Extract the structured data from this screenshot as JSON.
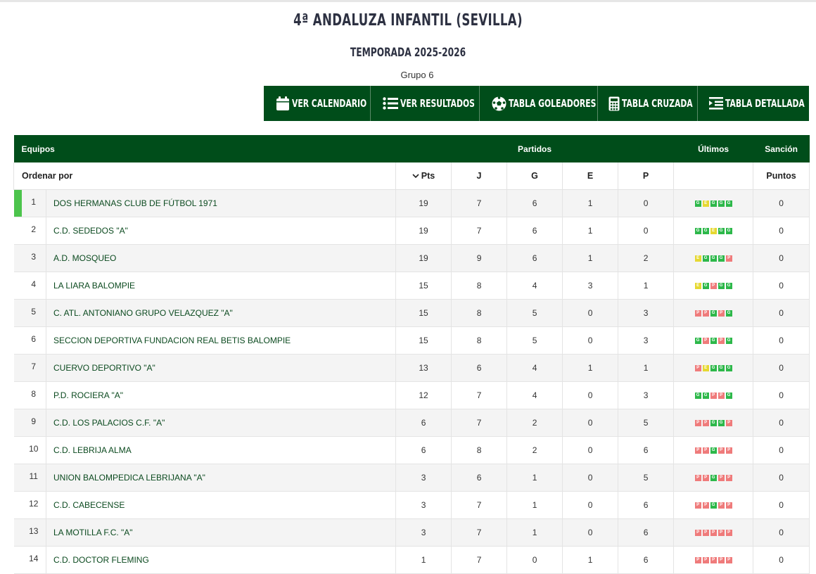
{
  "header": {
    "title": "4ª ANDALUZA INFANTIL (SEVILLA)",
    "season": "TEMPORADA 2025-2026",
    "group": "Grupo 6"
  },
  "actions": [
    {
      "label": "VER CALENDARIO",
      "icon": "calendar-icon"
    },
    {
      "label": "VER RESULTADOS",
      "icon": "list-icon"
    },
    {
      "label": "TABLA GOLEADORES",
      "icon": "ball-icon"
    },
    {
      "label": "TABLA CRUZADA",
      "icon": "calculator-icon"
    },
    {
      "label": "TABLA DETALLADA",
      "icon": "detailed-table-icon"
    }
  ],
  "table": {
    "head_teams": "Equipos",
    "head_matches": "Partidos",
    "head_last": "Últimos",
    "head_sanction": "Sanción",
    "sort_label": "Ordenar por",
    "col_pts": "Pts",
    "col_j": "J",
    "col_g": "G",
    "col_e": "E",
    "col_p": "P",
    "col_points": "Puntos",
    "colors": {
      "win": "#2db84a",
      "draw": "#e6d832",
      "loss": "#ef7b7b",
      "header": "#004d1a",
      "leader": "#4cc44c"
    },
    "rows": [
      {
        "pos": "1",
        "team": "DOS HERMANAS CLUB DE FÚTBOL 1971",
        "pts": "19",
        "j": "7",
        "g": "6",
        "e": "1",
        "p": "0",
        "last": [
          "G",
          "E",
          "G",
          "G",
          "G"
        ],
        "sanction": "0"
      },
      {
        "pos": "2",
        "team": "C.D. SEDEDOS \"A\"",
        "pts": "19",
        "j": "7",
        "g": "6",
        "e": "1",
        "p": "0",
        "last": [
          "G",
          "G",
          "E",
          "G",
          "G"
        ],
        "sanction": "0"
      },
      {
        "pos": "3",
        "team": "A.D. MOSQUEO",
        "pts": "19",
        "j": "9",
        "g": "6",
        "e": "1",
        "p": "2",
        "last": [
          "E",
          "G",
          "G",
          "G",
          "P"
        ],
        "sanction": "0"
      },
      {
        "pos": "4",
        "team": "LA LIARA BALOMPIE",
        "pts": "15",
        "j": "8",
        "g": "4",
        "e": "3",
        "p": "1",
        "last": [
          "E",
          "G",
          "P",
          "G",
          "G"
        ],
        "sanction": "0"
      },
      {
        "pos": "5",
        "team": "C. ATL. ANTONIANO GRUPO VELAZQUEZ \"A\"",
        "pts": "15",
        "j": "8",
        "g": "5",
        "e": "0",
        "p": "3",
        "last": [
          "P",
          "P",
          "G",
          "P",
          "G"
        ],
        "sanction": "0"
      },
      {
        "pos": "6",
        "team": "SECCION DEPORTIVA FUNDACION REAL BETIS BALOMPIE",
        "pts": "15",
        "j": "8",
        "g": "5",
        "e": "0",
        "p": "3",
        "last": [
          "G",
          "P",
          "G",
          "P",
          "G"
        ],
        "sanction": "0"
      },
      {
        "pos": "7",
        "team": "CUERVO DEPORTIVO \"A\"",
        "pts": "13",
        "j": "6",
        "g": "4",
        "e": "1",
        "p": "1",
        "last": [
          "P",
          "E",
          "G",
          "G",
          "G"
        ],
        "sanction": "0"
      },
      {
        "pos": "8",
        "team": "P.D. ROCIERA \"A\"",
        "pts": "12",
        "j": "7",
        "g": "4",
        "e": "0",
        "p": "3",
        "last": [
          "G",
          "G",
          "P",
          "P",
          "G"
        ],
        "sanction": "0"
      },
      {
        "pos": "9",
        "team": "C.D. LOS PALACIOS C.F. \"A\"",
        "pts": "6",
        "j": "7",
        "g": "2",
        "e": "0",
        "p": "5",
        "last": [
          "P",
          "P",
          "G",
          "G",
          "P"
        ],
        "sanction": "0"
      },
      {
        "pos": "10",
        "team": "C.D. LEBRIJA ALMA",
        "pts": "6",
        "j": "8",
        "g": "2",
        "e": "0",
        "p": "6",
        "last": [
          "P",
          "P",
          "G",
          "P",
          "P"
        ],
        "sanction": "0"
      },
      {
        "pos": "11",
        "team": "UNION BALOMPEDICA LEBRIJANA \"A\"",
        "pts": "3",
        "j": "6",
        "g": "1",
        "e": "0",
        "p": "5",
        "last": [
          "P",
          "P",
          "G",
          "P",
          "P"
        ],
        "sanction": "0"
      },
      {
        "pos": "12",
        "team": "C.D. CABECENSE",
        "pts": "3",
        "j": "7",
        "g": "1",
        "e": "0",
        "p": "6",
        "last": [
          "P",
          "P",
          "G",
          "P",
          "P"
        ],
        "sanction": "0"
      },
      {
        "pos": "13",
        "team": "LA MOTILLA F.C. \"A\"",
        "pts": "3",
        "j": "7",
        "g": "1",
        "e": "0",
        "p": "6",
        "last": [
          "P",
          "P",
          "P",
          "P",
          "P"
        ],
        "sanction": "0"
      },
      {
        "pos": "14",
        "team": "C.D. DOCTOR FLEMING",
        "pts": "1",
        "j": "7",
        "g": "0",
        "e": "1",
        "p": "6",
        "last": [
          "P",
          "P",
          "P",
          "P",
          "P"
        ],
        "sanction": "0"
      }
    ]
  }
}
